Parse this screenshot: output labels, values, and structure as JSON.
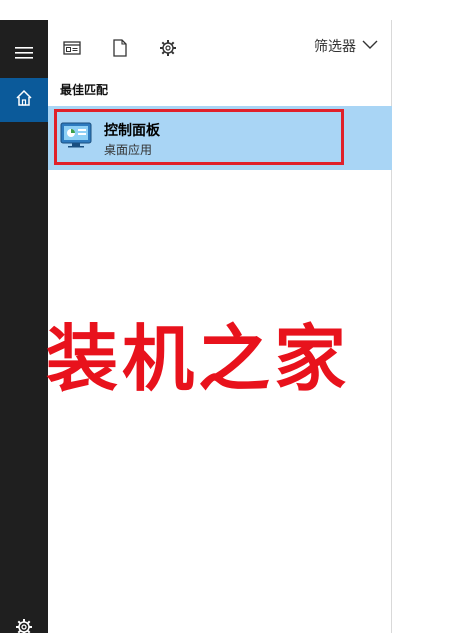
{
  "sidebar": {
    "menu_icon": "hamburger-menu-icon",
    "home_icon": "home-icon",
    "settings_icon": "settings-gear-icon"
  },
  "toolbar": {
    "apps_icon": "apps-filter-icon",
    "documents_icon": "document-icon",
    "settings_icon": "settings-gear-icon",
    "filter_label": "筛选器",
    "filter_icon": "chevron-down-icon"
  },
  "results": {
    "section_title": "最佳匹配",
    "best_match": {
      "title": "控制面板",
      "subtitle": "桌面应用",
      "icon": "control-panel-icon"
    }
  },
  "watermark": {
    "text": "装机之家",
    "color": "#e8121c"
  },
  "colors": {
    "rail_bg": "#1f1f1f",
    "rail_active": "#0b5a9a",
    "result_highlight": "#a9d5f5",
    "annotation_border": "#e0202a"
  }
}
